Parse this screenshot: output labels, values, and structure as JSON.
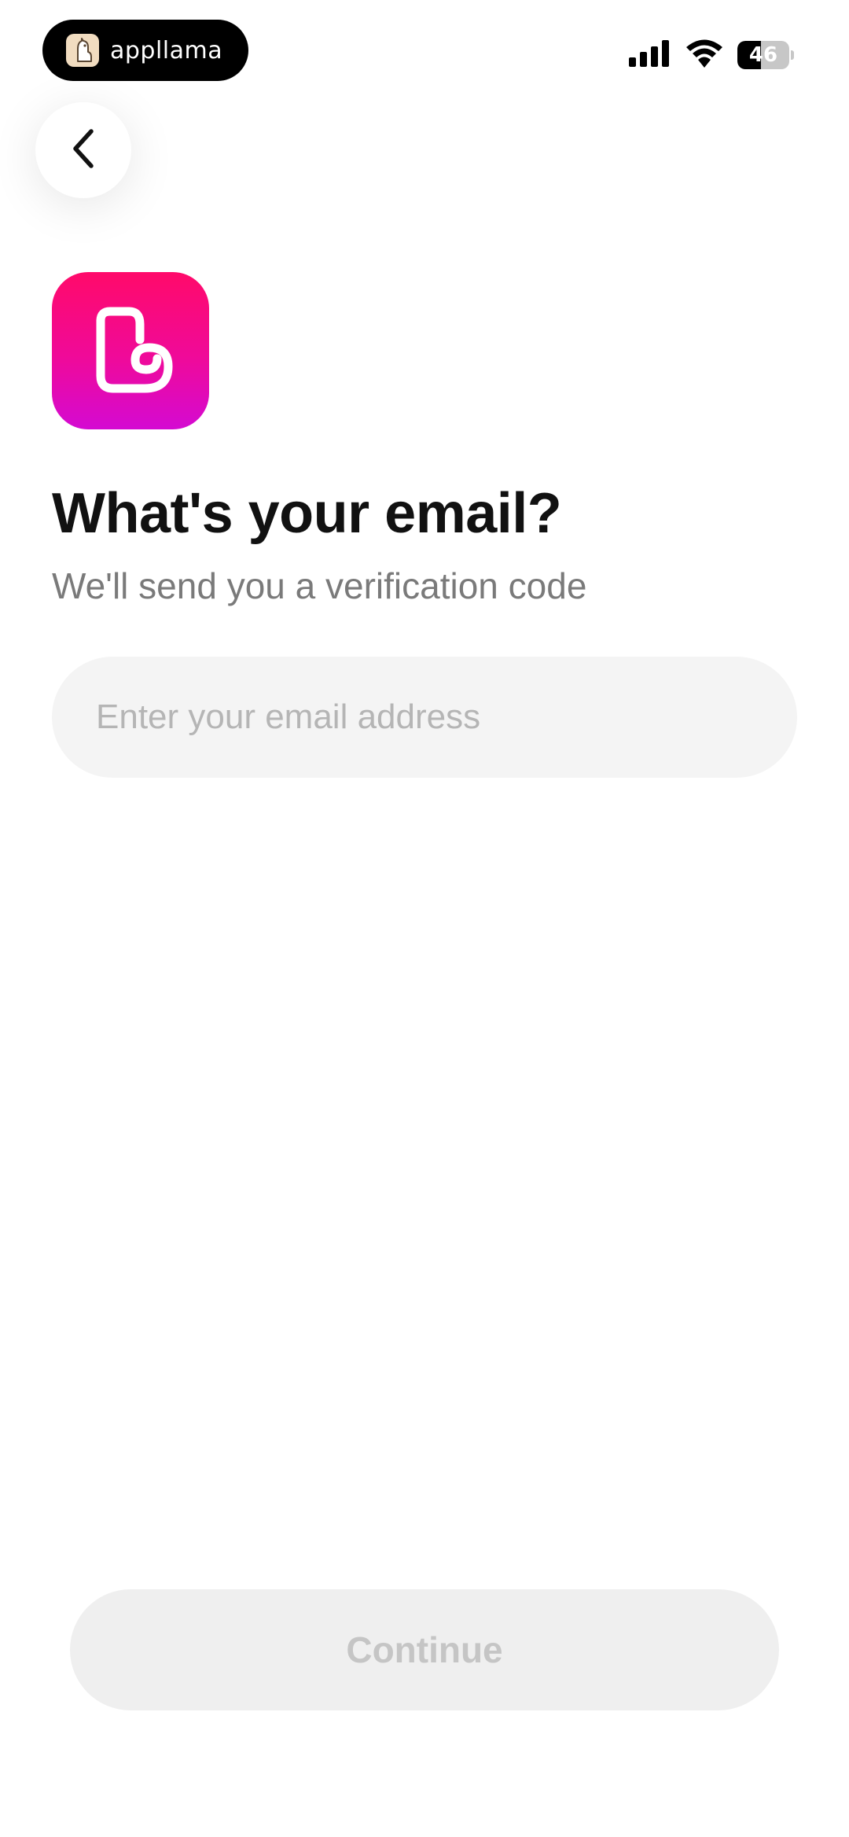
{
  "status_bar": {
    "brand_name": "appllama",
    "battery_level": "46",
    "battery_fraction": 0.46,
    "icons": [
      "cellular-signal-icon",
      "wifi-icon",
      "battery-icon"
    ]
  },
  "nav": {
    "back_icon": "chevron-left-icon"
  },
  "app": {
    "icon_name": "app-logo-icon",
    "colors": {
      "gradient_top": "#ff0a6a",
      "gradient_bottom": "#d40ad2"
    }
  },
  "header": {
    "title": "What's your email?",
    "subtitle": "We'll send you a verification code"
  },
  "form": {
    "email_value": "",
    "email_placeholder": "Enter your email address"
  },
  "footer": {
    "continue_label": "Continue"
  }
}
